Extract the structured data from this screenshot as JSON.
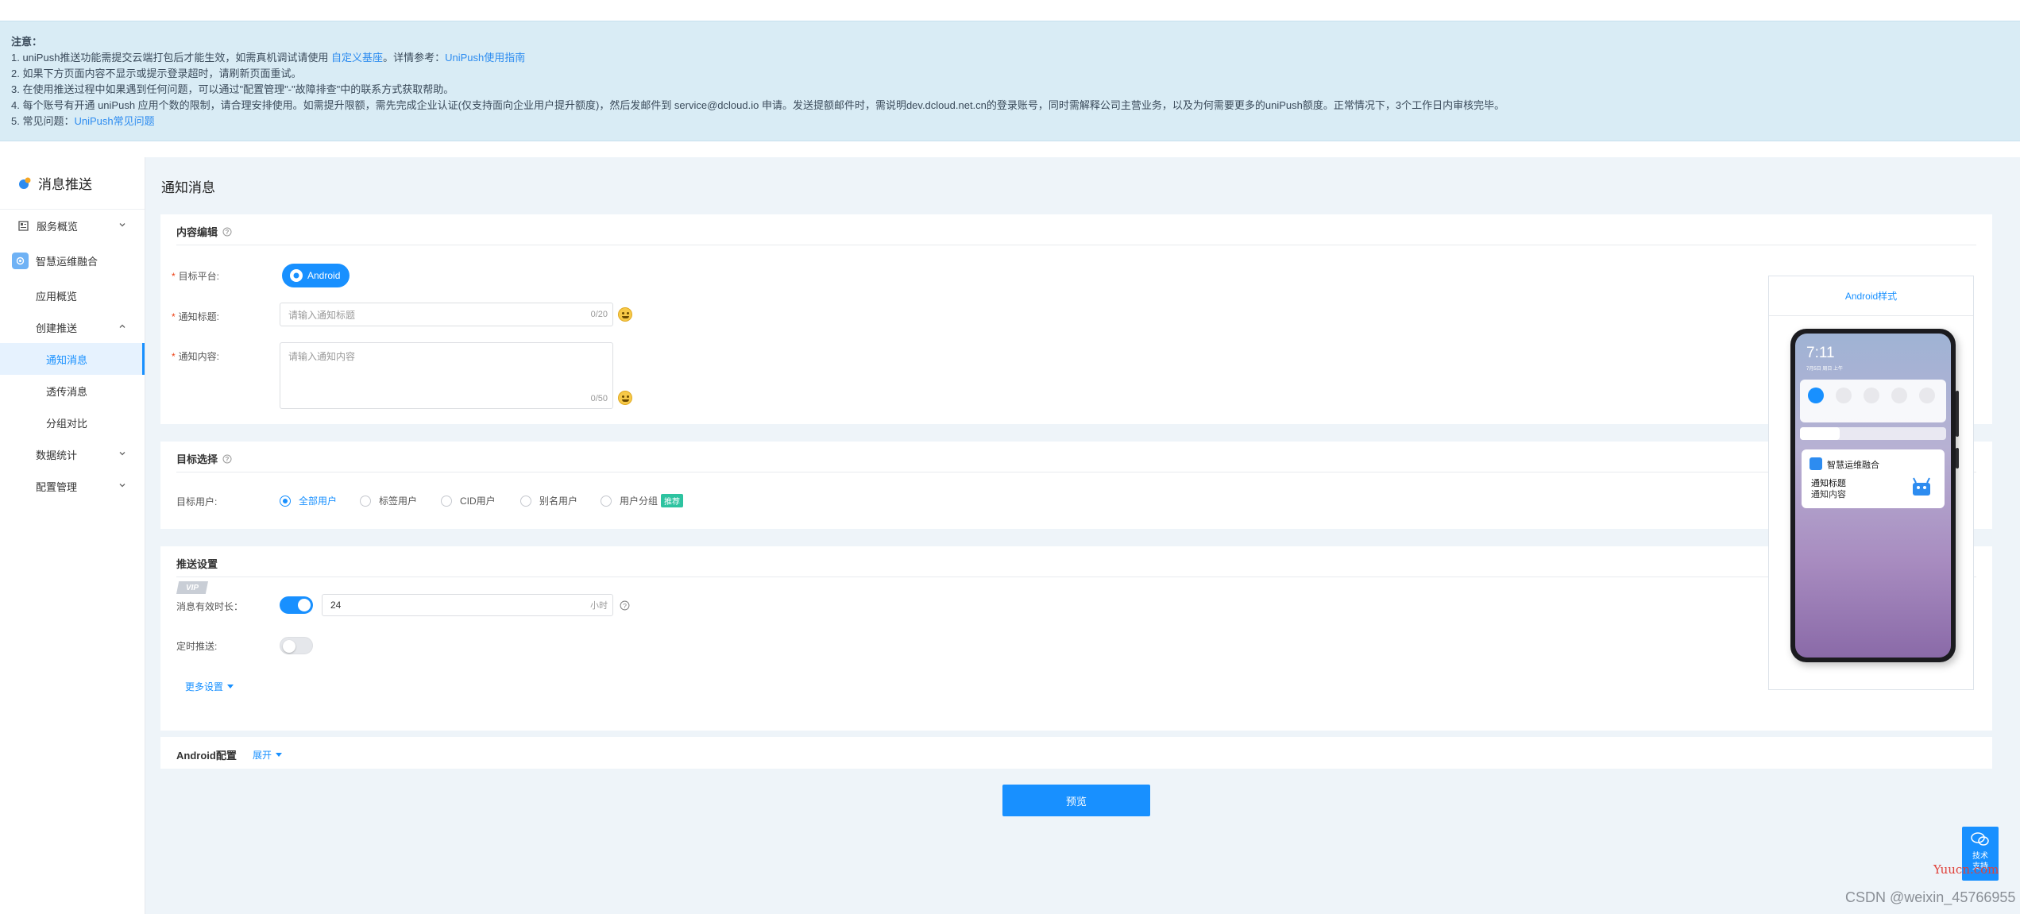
{
  "notice": {
    "title": "注意：",
    "lines": [
      {
        "prefix": "1. uniPush推送功能需提交云端打包后才能生效，如需真机调试请使用 ",
        "link1": "自定义基座",
        "mid": "。详情参考：",
        "link2": "UniPush使用指南"
      },
      {
        "text": "2. 如果下方页面内容不显示或提示登录超时，请刷新页面重试。"
      },
      {
        "text": "3. 在使用推送过程中如果遇到任何问题，可以通过\"配置管理\"-\"故障排查\"中的联系方式获取帮助。"
      },
      {
        "text": "4. 每个账号有开通 uniPush 应用个数的限制，请合理安排使用。如需提升限额，需先完成企业认证(仅支持面向企业用户提升额度)，然后发邮件到 service@dcloud.io 申请。发送提额邮件时，需说明dev.dcloud.net.cn的登录账号，同时需解释公司主营业务，以及为何需要更多的uniPush额度。正常情况下，3个工作日内审核完毕。"
      },
      {
        "prefix": "5. 常见问题：",
        "link1": "UniPush常见问题"
      }
    ]
  },
  "sidebar": {
    "header": "消息推送",
    "items": [
      {
        "label": "服务概览"
      },
      {
        "label": "智慧运维融合"
      },
      {
        "label": "应用概览"
      },
      {
        "label": "创建推送"
      },
      {
        "label": "通知消息"
      },
      {
        "label": "透传消息"
      },
      {
        "label": "分组对比"
      },
      {
        "label": "数据统计"
      },
      {
        "label": "配置管理"
      }
    ]
  },
  "main": {
    "title": "通知消息",
    "content_card": {
      "title": "内容编辑",
      "platform_label": "目标平台:",
      "platform_value": "Android",
      "notif_title_label": "通知标题:",
      "notif_title_placeholder": "请输入通知标题",
      "notif_title_counter": "0/20",
      "notif_content_label": "通知内容:",
      "notif_content_placeholder": "请输入通知内容",
      "notif_content_counter": "0/50"
    },
    "target_card": {
      "title": "目标选择",
      "target_label": "目标用户:",
      "options": [
        "全部用户",
        "标签用户",
        "CID用户",
        "别名用户",
        "用户分组"
      ],
      "selected": "全部用户",
      "recommend_tag": "推荐"
    },
    "push_card": {
      "title": "推送设置",
      "vip": "VIP",
      "ttl_label": "消息有效时长：",
      "ttl_value": "24",
      "ttl_unit": "小时",
      "schedule_label": "定时推送:",
      "more_settings": "更多设置"
    },
    "android_card": {
      "title": "Android配置",
      "expand": "展开"
    },
    "preview_button": "预览"
  },
  "preview": {
    "tab": "Android样式",
    "time": "7:11",
    "date": "7月5日 周日 上午",
    "app_name": "智慧运维融合",
    "notif_title": "通知标题",
    "notif_content": "通知内容"
  },
  "float": {
    "help_label": "技术支持"
  },
  "watermark": "Yuucn.com",
  "csdn": "CSDN @weixin_45766955",
  "colors": {
    "primary": "#1890ff",
    "notice_bg": "#d9ecf5",
    "main_bg": "#eef4f9",
    "required": "#ed4014"
  }
}
